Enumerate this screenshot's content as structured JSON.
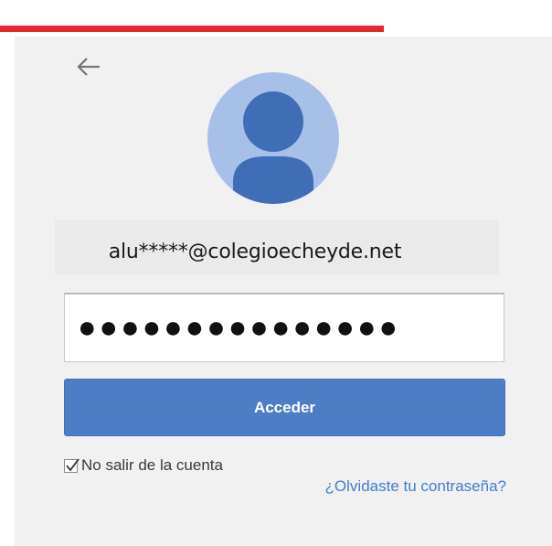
{
  "header": {
    "accent_color": "#e52a2f"
  },
  "login": {
    "back_icon": "arrow-left-icon",
    "avatar_icon": "user-silhouette-icon",
    "email": "alu*****@colegioecheyde.net",
    "password_masked": "●●●●●●●●●●●●●●●",
    "submit_label": "Acceder",
    "stay_signed_in_label": "No salir de la cuenta",
    "stay_signed_in_checked": true,
    "forgot_password_link": "¿Olvidaste tu contraseña?"
  },
  "colors": {
    "button": "#4d7dc4",
    "link": "#3f7dd2",
    "avatar_bg": "#a6c0e8",
    "avatar_fg": "#3f6db6",
    "card_bg": "#f1f1f1"
  }
}
